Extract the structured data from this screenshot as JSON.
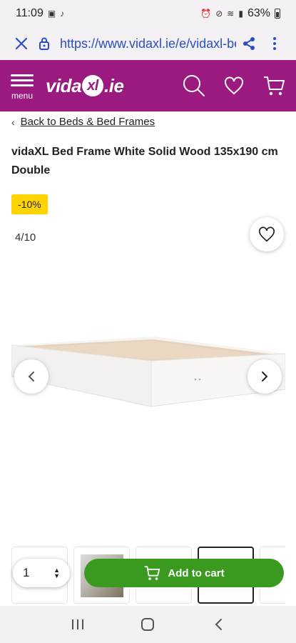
{
  "status_bar": {
    "time": "11:09",
    "battery": "63%"
  },
  "browser": {
    "url": "https://www.vidaxl.ie/e/vidaxl-bed-frame"
  },
  "site_header": {
    "logo_left": "vida",
    "logo_xl": "xl",
    "logo_right": ".ie",
    "menu_label": "menu"
  },
  "breadcrumb": {
    "chevron": "‹",
    "link": "Back to Beds & Bed Frames"
  },
  "product": {
    "title": "vidaXL Bed Frame White Solid Wood 135x190 cm Double",
    "discount": "-10%",
    "image_counter": "4/10",
    "thumbnail_count": 5,
    "active_thumbnail_index": 3
  },
  "cart_bar": {
    "quantity": "1",
    "add_to_cart_label": "Add to cart"
  },
  "colors": {
    "brand_purple": "#9a1a7f",
    "cart_green": "#3a9a1f",
    "badge_yellow": "#ffd400",
    "browser_blue": "#2a4fc4"
  }
}
